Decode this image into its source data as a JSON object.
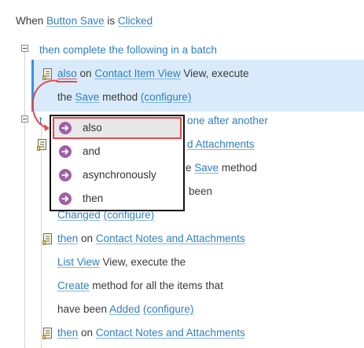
{
  "header": {
    "prefix": "When",
    "trigger_target": "Button Save",
    "is_word": "is",
    "trigger_event": "Clicked"
  },
  "batch": {
    "text": "then complete the following in a batch"
  },
  "action1": {
    "connector": "also",
    "on_word": "on",
    "target": "Contact Item View",
    "suffix": "View, execute",
    "line2_prefix": "the",
    "method": "Save",
    "method_suffix": "method",
    "configure": "(configure)"
  },
  "partial_rows": {
    "row_then_tail": "one after another",
    "row_attach_tail": "d Attachments",
    "row_save_pre": "e",
    "row_save_method": "Save",
    "row_save_suffix": "method",
    "row_been": "been",
    "row_changed": "Changed",
    "row_changed_configure": "(configure)"
  },
  "action3": {
    "connector": "then",
    "on_word": "on",
    "target": "Contact Notes and Attachments",
    "view": "List View",
    "view_suffix": "View, execute the",
    "method": "Create",
    "method_suffix": "method for all the items that",
    "line4_prefix": "have been",
    "status": "Added",
    "configure": "(configure)"
  },
  "action4": {
    "connector": "then",
    "on_word": "on",
    "target": "Contact Notes and Attachments"
  },
  "dropdown": {
    "options": [
      "also",
      "and",
      "asynchronously",
      "then"
    ],
    "selected": "also"
  },
  "colors": {
    "link": "#2f7fc1",
    "selection_bg": "#d9ebfa",
    "selection_bar": "#3a8ee6",
    "highlight_red": "#e5484d",
    "option_icon": "#a15fa6"
  }
}
